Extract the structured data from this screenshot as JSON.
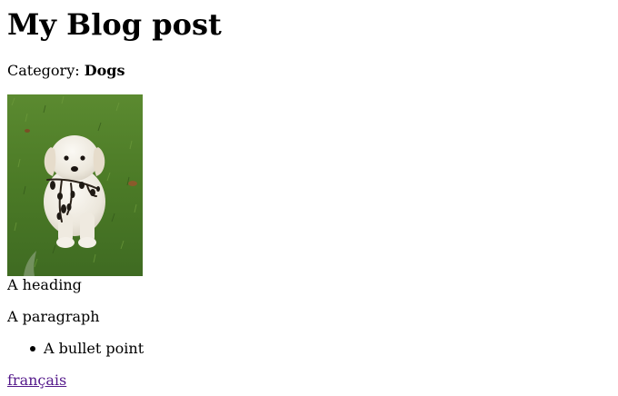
{
  "title": "My Blog post",
  "category": {
    "label": "Category:",
    "value": "Dogs"
  },
  "image": {
    "subject": "white puppy sitting on grass holding a branch",
    "colors": {
      "grass": "#4f7a2a",
      "puppy": "#eeeae2"
    }
  },
  "content": {
    "heading": "A heading",
    "paragraph": "A paragraph",
    "bullets": [
      "A bullet point"
    ]
  },
  "language_link": {
    "label": "français",
    "color": "#551a8b"
  }
}
